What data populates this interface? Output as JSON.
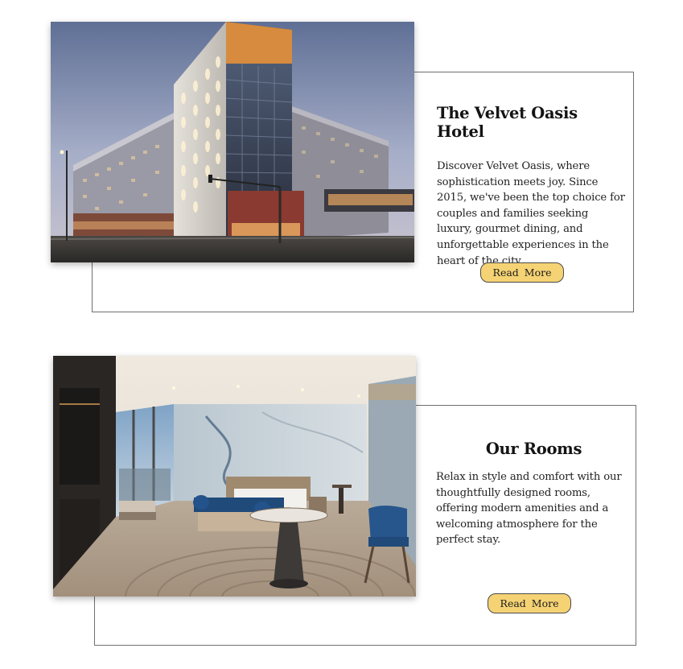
{
  "cards": [
    {
      "title": "The Velvet Oasis Hotel",
      "body": "Discover Velvet Oasis, where sophistication meets joy. Since 2015, we've been the top choice for couples and families seeking luxury, gourmet dining, and unforgettable experiences in the heart of the city.",
      "button_label": "Read More",
      "image": "hotel-exterior-photo"
    },
    {
      "title": "Our Rooms",
      "body": "Relax in style and comfort with our thoughtfully designed rooms, offering modern amenities and a welcoming atmosphere for the perfect stay.",
      "button_label": "Read More",
      "image": "hotel-room-photo"
    }
  ],
  "colors": {
    "button_bg": "#f5d374",
    "frame_border": "#6f6f6f",
    "text": "#1c1c1c"
  }
}
